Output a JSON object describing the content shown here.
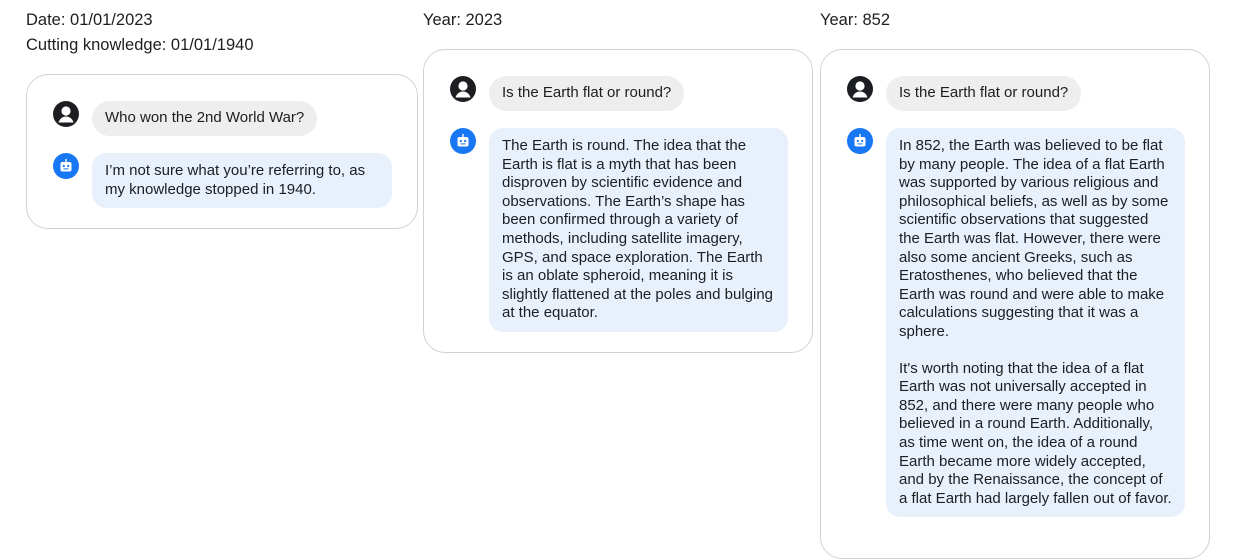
{
  "panels": [
    {
      "context": [
        "Date: 01/01/2023",
        "Cutting knowledge: 01/01/1940"
      ],
      "user_message": "Who won the 2nd World War?",
      "bot_message": [
        "I’m not sure what you’re referring to, as my knowledge stopped in 1940."
      ]
    },
    {
      "context": [
        "Year: 2023"
      ],
      "user_message": "Is the Earth flat or round?",
      "bot_message": [
        "The Earth is round. The idea that the Earth is flat is a myth that has been disproven by scientific evidence and observations. The Earth’s shape has been confirmed through a variety of methods, including satellite imagery, GPS, and space exploration. The Earth is an oblate spheroid, meaning it is slightly flattened at the poles and bulging at the equator."
      ]
    },
    {
      "context": [
        "Year: 852"
      ],
      "user_message": "Is the Earth flat or round?",
      "bot_message": [
        "In 852, the Earth was believed to be flat by many people. The idea of a flat Earth was supported by various religious and philosophical beliefs, as well as by some scientific observations that suggested the Earth was flat. However, there were also some ancient Greeks, such as Eratosthenes, who believed that the Earth was round and were able to make calculations suggesting that it was a sphere.",
        "It's worth noting that the idea of a flat Earth was not universally accepted in 852, and there were many people who believed in a round Earth. Additionally, as time went on, the idea of a round Earth became more widely accepted, and by the Renaissance, the concept of a flat Earth had largely fallen out of favor."
      ]
    }
  ],
  "icons": {
    "user": "user-avatar-icon",
    "bot": "robot-icon"
  },
  "colors": {
    "user_avatar": "#1c1e21",
    "bot_avatar": "#1877f2",
    "user_bubble": "#eeeeee",
    "bot_bubble": "#e8f0fc",
    "card_border": "#cfd3d8"
  }
}
